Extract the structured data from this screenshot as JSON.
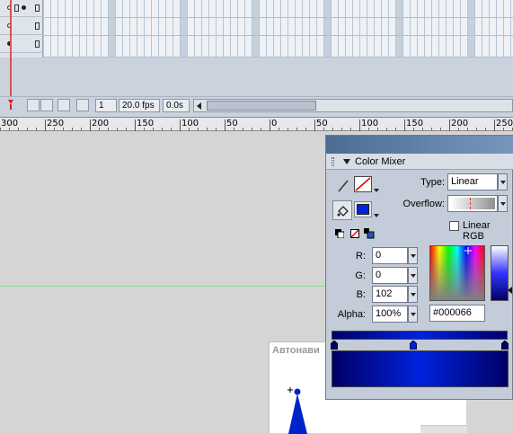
{
  "timeline": {
    "current_frame": "1",
    "fps": "20.0 fps",
    "elapsed": "0.0s"
  },
  "ruler": {
    "labels": [
      "300",
      "250",
      "200",
      "150",
      "100",
      "50",
      "0",
      "50",
      "100",
      "150",
      "200",
      "250"
    ]
  },
  "stage": {
    "artboard_title": "Автонави"
  },
  "color_mixer": {
    "title": "Color Mixer",
    "type_label": "Type:",
    "type_value": "Linear",
    "overflow_label": "Overflow:",
    "linear_rgb_label": "Linear RGB",
    "linear_rgb_checked": false,
    "r_label": "R:",
    "r_value": "0",
    "g_label": "G:",
    "g_value": "0",
    "b_label": "B:",
    "b_value": "102",
    "alpha_label": "Alpha:",
    "alpha_value": "100%",
    "hex_value": "#000066",
    "colors": {
      "fill": "#0022dd",
      "dark_stop": "#000066"
    }
  },
  "icons": [
    "pencil-icon",
    "paint-bucket-icon",
    "black-white-icon",
    "no-color-icon",
    "swap-colors-icon",
    "playhead-icon",
    "eye-icon",
    "lock-icon"
  ]
}
